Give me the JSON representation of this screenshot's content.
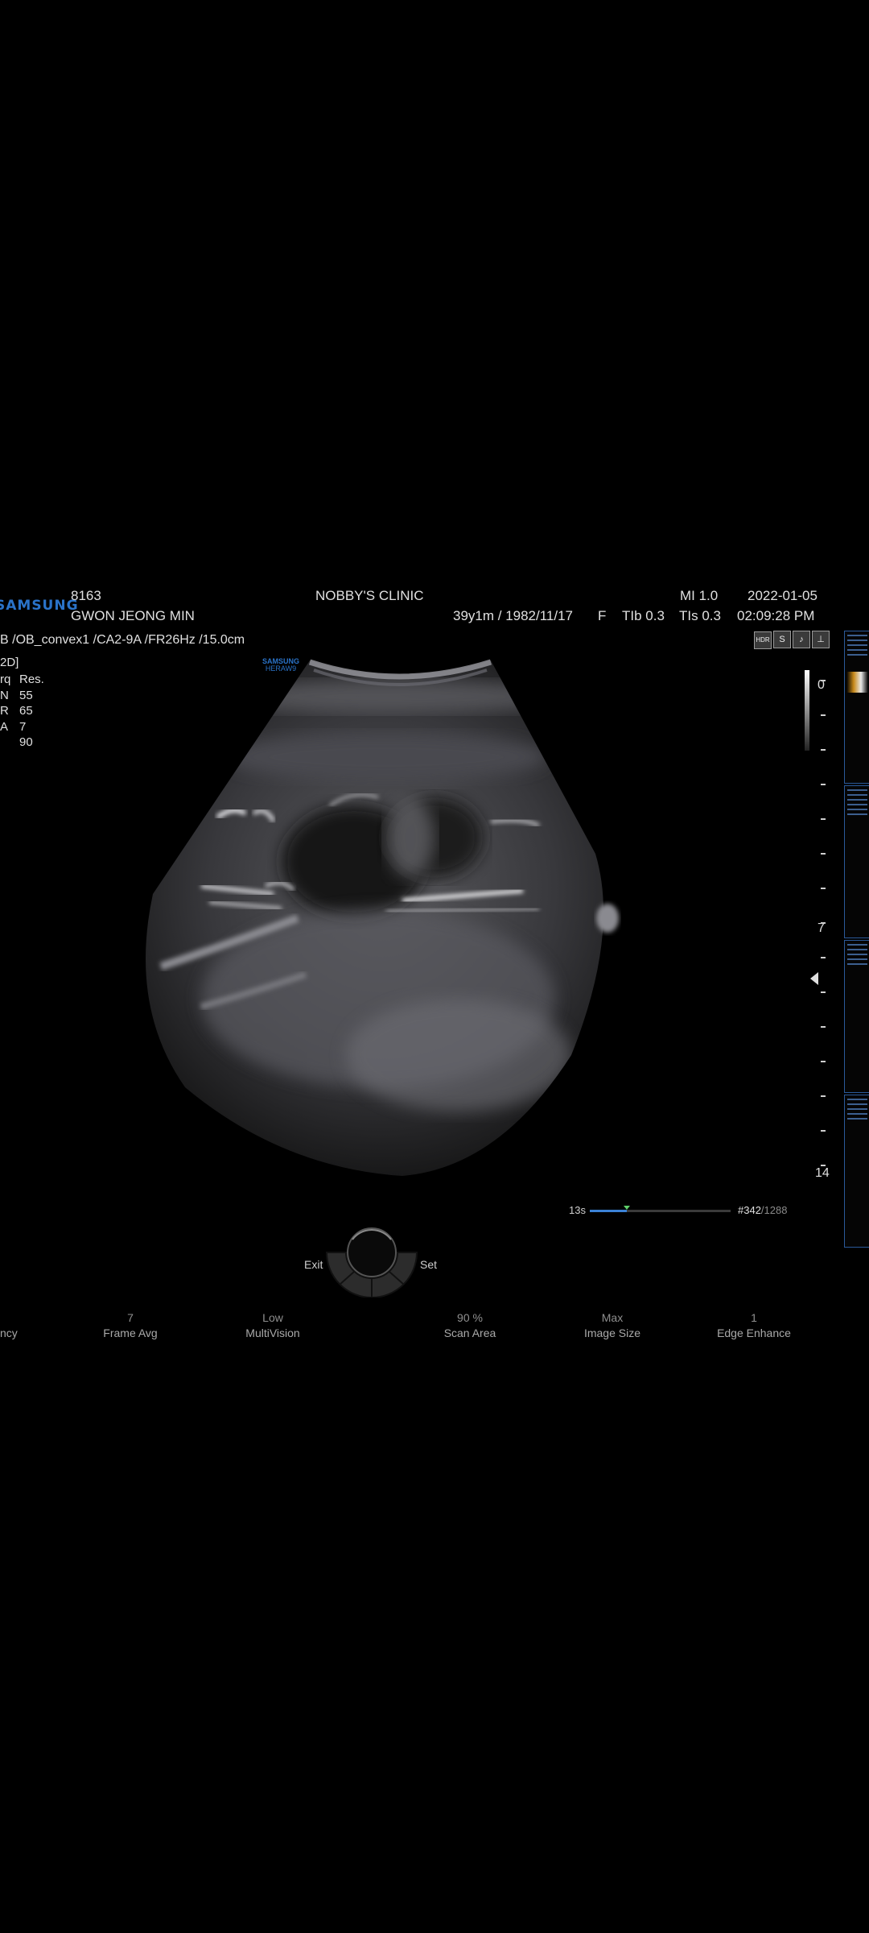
{
  "header": {
    "brand_logo": "SAMSUNG",
    "patient_id": "8163",
    "patient_name": "GWON JEONG MIN",
    "clinic": "NOBBY'S CLINIC",
    "mi": "MI  1.0",
    "date": "2022-01-05",
    "patient_info": "39y1m / 1982/11/17",
    "sex": "F",
    "tib": "TIb 0.3",
    "tis": "TIs 0.3",
    "time": "02:09:28 PM"
  },
  "probe_line": "B  /OB_convex1  /CA2-9A  /FR26Hz  /15.0cm",
  "mode": "2D]",
  "params": [
    {
      "key": "rq",
      "value": "Res."
    },
    {
      "key": "N",
      "value": "55"
    },
    {
      "key": "R",
      "value": "65"
    },
    {
      "key": "A",
      "value": "7"
    },
    {
      "key": "",
      "value": "90"
    }
  ],
  "system_logo": {
    "line1": "SAMSUNG",
    "line2": "HERAW9"
  },
  "status_icons": [
    "HDR",
    "S",
    "♪",
    "⊥"
  ],
  "depth_scale": {
    "top": "0",
    "mid": "7",
    "bottom": "14"
  },
  "cine": {
    "elapsed": "13s",
    "frame": "#342",
    "total": "/1288",
    "progress": 0.265
  },
  "trackball": {
    "exit": "Exit",
    "set": "Set"
  },
  "controls": [
    {
      "value": "",
      "label": "ncy"
    },
    {
      "value": "7",
      "label": "Frame Avg"
    },
    {
      "value": "Low",
      "label": "MultiVision"
    },
    {
      "value": "90 %",
      "label": "Scan Area"
    },
    {
      "value": "Max",
      "label": "Image Size"
    },
    {
      "value": "1",
      "label": "Edge Enhance"
    }
  ],
  "colors": {
    "brand": "#2a73c9",
    "cine_bar": "#3b82d6",
    "thumb_border": "#2b5a9a"
  }
}
